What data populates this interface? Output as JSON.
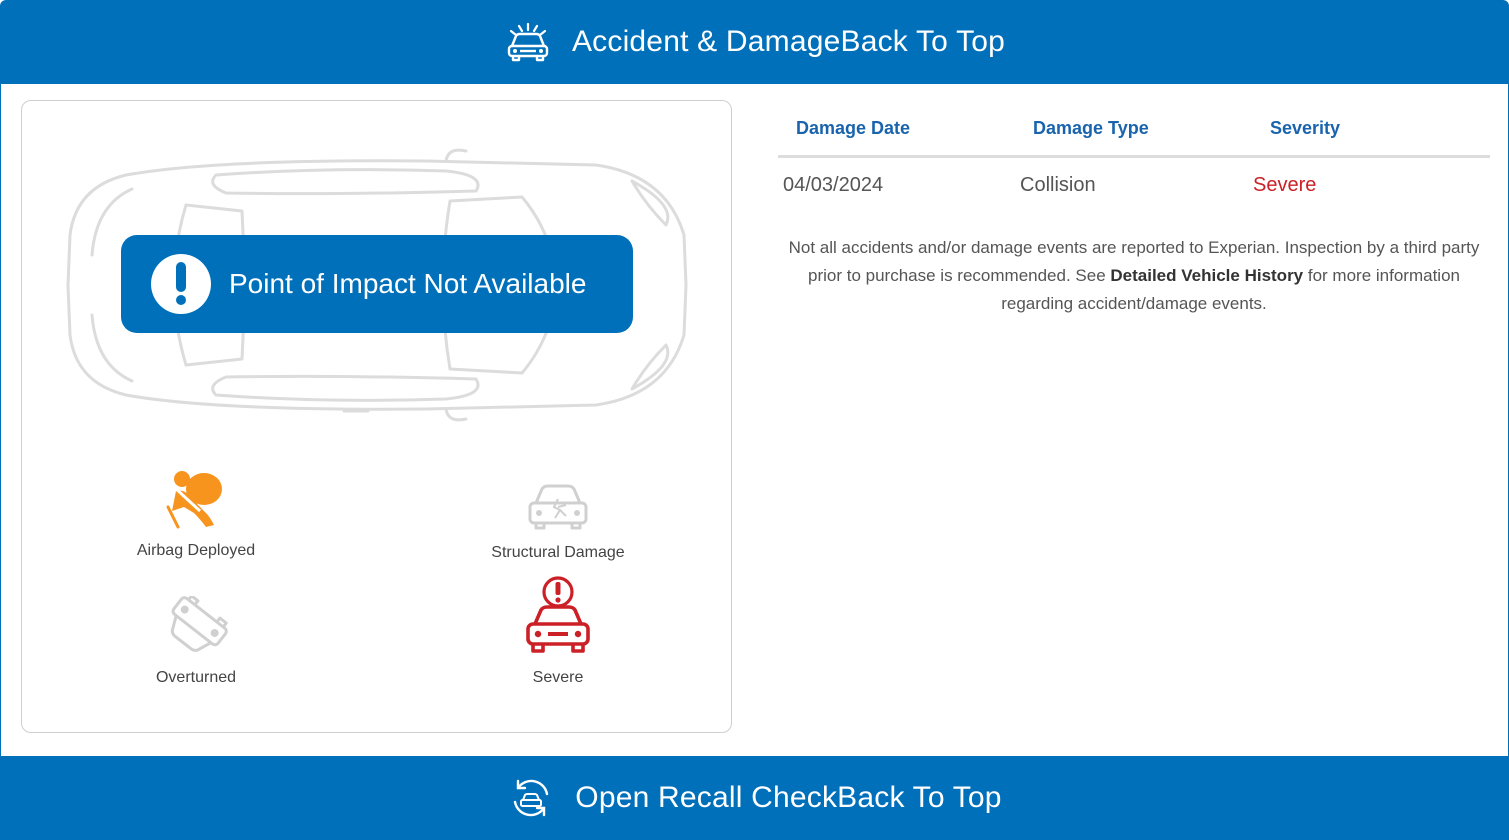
{
  "accident_section": {
    "title": "Accident & Damage",
    "back_to_top": "Back To Top",
    "icon": "car-crash-icon"
  },
  "impact": {
    "message": "Point of Impact Not Available",
    "icon": "exclamation-icon"
  },
  "indicators": {
    "airbag": {
      "label": "Airbag Deployed",
      "active": true,
      "color": "#f7941d",
      "icon": "airbag-icon"
    },
    "structural": {
      "label": "Structural Damage",
      "active": false,
      "color": "#d0d0d0",
      "icon": "structural-damage-icon"
    },
    "overturned": {
      "label": "Overturned",
      "active": false,
      "color": "#d0d0d0",
      "icon": "overturned-car-icon"
    },
    "severe": {
      "label": "Severe",
      "active": true,
      "color": "#cc2027",
      "icon": "severe-damage-icon"
    }
  },
  "damage_table": {
    "headers": [
      "Damage Date",
      "Damage Type",
      "Severity"
    ],
    "rows": [
      {
        "date": "04/03/2024",
        "type": "Collision",
        "severity": "Severe"
      }
    ]
  },
  "disclaimer": {
    "before": "Not all accidents and/or damage events are reported to Experian. Inspection by a third party prior to purchase is recommended. See ",
    "link": "Detailed Vehicle History",
    "after": " for more information regarding accident/damage events."
  },
  "recall_section": {
    "title": "Open Recall Check",
    "back_to_top": "Back To Top",
    "icon": "recall-check-icon"
  },
  "colors": {
    "brand_blue": "#0170bb",
    "header_text_blue": "#1a64ad",
    "severe_red": "#cc2027",
    "airbag_orange": "#f7941d"
  }
}
